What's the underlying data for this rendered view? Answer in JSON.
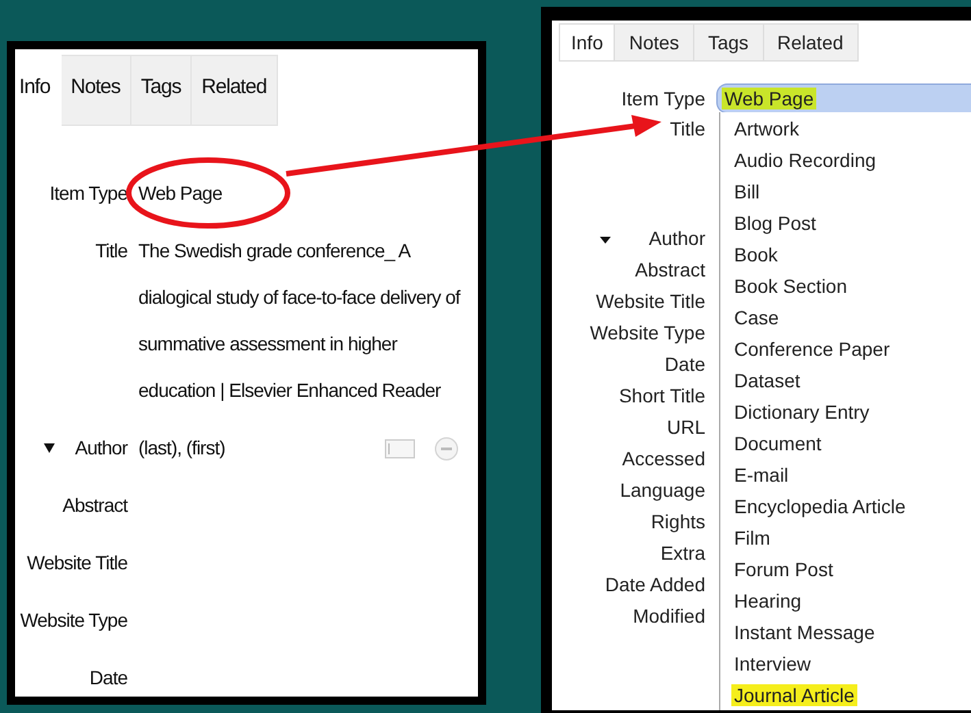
{
  "left_panel": {
    "tabs": [
      {
        "label": "Info",
        "selected": true
      },
      {
        "label": "Notes",
        "selected": false
      },
      {
        "label": "Tags",
        "selected": false
      },
      {
        "label": "Related",
        "selected": false
      }
    ],
    "fields": [
      {
        "kind": "text",
        "label": "Item Type",
        "value": "Web Page"
      },
      {
        "kind": "text",
        "label": "Title",
        "value": "The Swedish grade conference_ A dialogical study of face-to-face delivery of summative assessment in higher education | Elsevier Enhanced Reader"
      },
      {
        "kind": "creator",
        "label": "Author",
        "value": "(last), (first)",
        "expanded": true
      },
      {
        "kind": "text",
        "label": "Abstract"
      },
      {
        "kind": "text",
        "label": "Website Title"
      },
      {
        "kind": "text",
        "label": "Website Type"
      },
      {
        "kind": "text",
        "label": "Date"
      }
    ]
  },
  "right_panel": {
    "tabs": [
      {
        "label": "Info",
        "selected": true
      },
      {
        "label": "Notes",
        "selected": false
      },
      {
        "label": "Tags",
        "selected": false
      },
      {
        "label": "Related",
        "selected": false
      }
    ],
    "item_type": {
      "label": "Item Type",
      "value": "Web Page",
      "highlighted": true
    },
    "fields": [
      {
        "kind": "title",
        "label": "Title"
      },
      {
        "kind": "creator",
        "label": "Author",
        "expanded": true
      },
      {
        "kind": "text",
        "label": "Abstract"
      },
      {
        "kind": "text",
        "label": "Website Title"
      },
      {
        "kind": "text",
        "label": "Website Type"
      },
      {
        "kind": "text",
        "label": "Date"
      },
      {
        "kind": "text",
        "label": "Short Title"
      },
      {
        "kind": "text",
        "label": "URL"
      },
      {
        "kind": "text",
        "label": "Accessed"
      },
      {
        "kind": "text",
        "label": "Language"
      },
      {
        "kind": "text",
        "label": "Rights"
      },
      {
        "kind": "text",
        "label": "Extra"
      },
      {
        "kind": "text",
        "label": "Date Added"
      },
      {
        "kind": "text",
        "label": "Modified"
      }
    ],
    "dropdown_options": [
      {
        "label": "Artwork",
        "highlighted": false
      },
      {
        "label": "Audio Recording",
        "highlighted": false
      },
      {
        "label": "Bill",
        "highlighted": false
      },
      {
        "label": "Blog Post",
        "highlighted": false
      },
      {
        "label": "Book",
        "highlighted": false
      },
      {
        "label": "Book Section",
        "highlighted": false
      },
      {
        "label": "Case",
        "highlighted": false
      },
      {
        "label": "Conference Paper",
        "highlighted": false
      },
      {
        "label": "Dataset",
        "highlighted": false
      },
      {
        "label": "Dictionary Entry",
        "highlighted": false
      },
      {
        "label": "Document",
        "highlighted": false
      },
      {
        "label": "E-mail",
        "highlighted": false
      },
      {
        "label": "Encyclopedia Article",
        "highlighted": false
      },
      {
        "label": "Film",
        "highlighted": false
      },
      {
        "label": "Forum Post",
        "highlighted": false
      },
      {
        "label": "Hearing",
        "highlighted": false
      },
      {
        "label": "Instant Message",
        "highlighted": false
      },
      {
        "label": "Interview",
        "highlighted": false
      },
      {
        "label": "Journal Article",
        "highlighted": true
      }
    ]
  }
}
